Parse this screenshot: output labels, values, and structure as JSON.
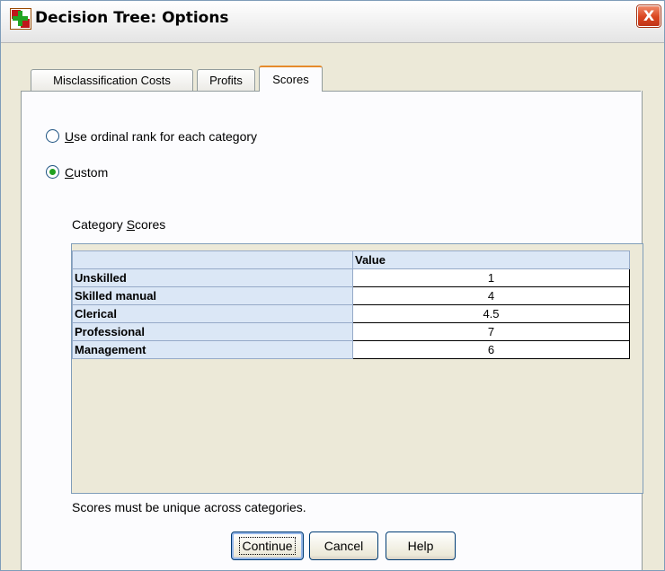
{
  "window": {
    "title": "Decision Tree: Options",
    "close_glyph": "X"
  },
  "tabs": [
    {
      "label": "Misclassification Costs",
      "active": false
    },
    {
      "label": "Profits",
      "active": false
    },
    {
      "label": "Scores",
      "active": true
    }
  ],
  "radios": {
    "ordinal": {
      "label_u": "U",
      "label_rest": "se ordinal rank for each category",
      "checked": false
    },
    "custom": {
      "label_u": "C",
      "label_rest": "ustom",
      "checked": true
    }
  },
  "category_scores": {
    "label_pre": "Category ",
    "label_u": "S",
    "label_rest": "cores",
    "column_header": "Value",
    "rows": [
      {
        "category": "Unskilled",
        "value": "1"
      },
      {
        "category": "Skilled manual",
        "value": "4"
      },
      {
        "category": "Clerical",
        "value": "4.5"
      },
      {
        "category": "Professional",
        "value": "7"
      },
      {
        "category": "Management",
        "value": "6"
      }
    ]
  },
  "note": "Scores must be unique across categories.",
  "buttons": {
    "continue": "Continue",
    "cancel": "Cancel",
    "help": "Help"
  },
  "colors": {
    "active_tab_accent": "#e68b2c",
    "header_fill": "#dbe7f6",
    "close_red": "#d9451f"
  }
}
